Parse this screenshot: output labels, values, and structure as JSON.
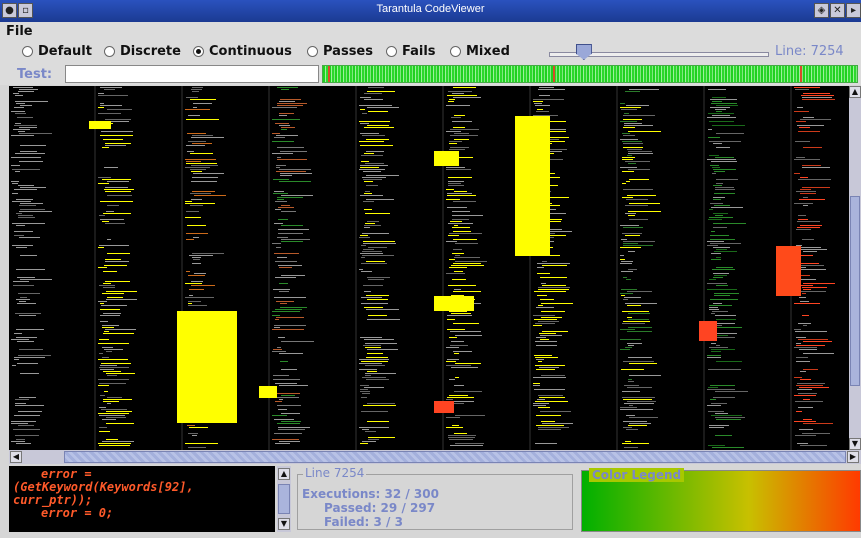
{
  "window": {
    "title": "Tarantula CodeViewer"
  },
  "menu": {
    "file": "File"
  },
  "modes": [
    {
      "label": "Default",
      "selected": false
    },
    {
      "label": "Discrete",
      "selected": false
    },
    {
      "label": "Continuous",
      "selected": true
    },
    {
      "label": "Passes",
      "selected": false
    },
    {
      "label": "Fails",
      "selected": false
    },
    {
      "label": "Mixed",
      "selected": false
    }
  ],
  "slider": {
    "line_label": "Line: 7254",
    "position": 0.16
  },
  "test": {
    "label": "Test:",
    "value": ""
  },
  "colors": {
    "pass": "#22cc22",
    "fail": "#ff4422",
    "suspicious": "#ffff00",
    "neutral": "#999999",
    "accent": "#7a88c8"
  },
  "source": {
    "lines": [
      "error =",
      "(GetKeyword(Keywords[92],",
      "curr_ptr));",
      "error = 0;"
    ]
  },
  "info": {
    "title": "Line 7254",
    "executions": "Executions: 32 / 300",
    "passed": "Passed: 29 / 297",
    "failed": "Failed: 3 / 3"
  },
  "legend": {
    "title": "Color Legend"
  }
}
